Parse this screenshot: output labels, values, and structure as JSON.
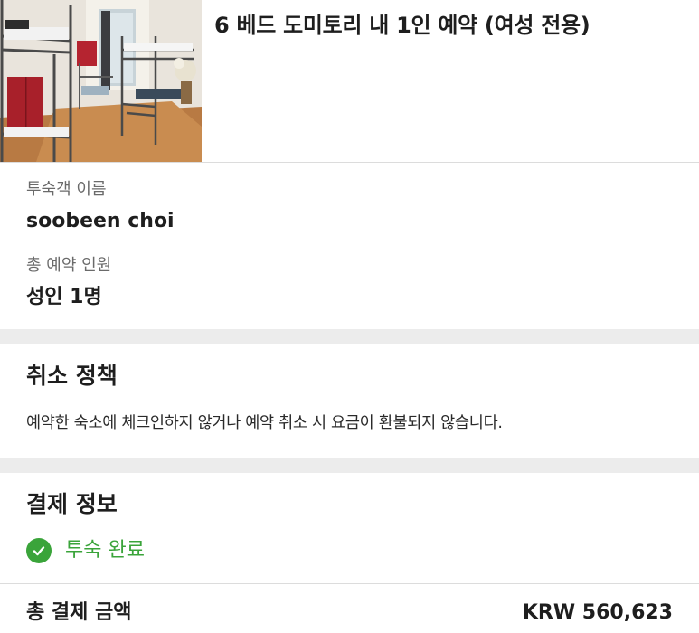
{
  "room": {
    "title": "6 베드 도미토리 내 1인 예약 (여성 전용)",
    "photo_icon": "dormitory-room-photo"
  },
  "guest": {
    "name_label": "투숙객 이름",
    "name_value": "soobeen choi",
    "count_label": "총 예약 인원",
    "count_value": "성인 1명"
  },
  "cancellation": {
    "title": "취소 정책",
    "text": "예약한 숙소에 체크인하지 않거나 예약 취소 시 요금이 환불되지 않습니다."
  },
  "payment": {
    "title": "결제 정보",
    "status_icon": "check-circle-icon",
    "status_text": "투숙 완료",
    "status_color": "#3aa43a",
    "total_label": "총 결제 금액",
    "total_amount": "KRW 560,623"
  }
}
